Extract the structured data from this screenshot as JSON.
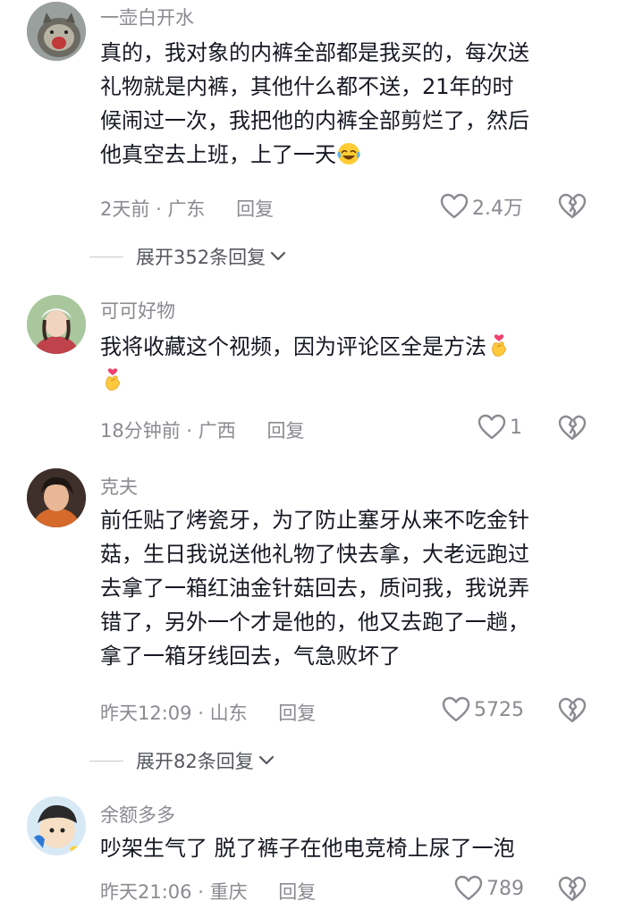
{
  "comments": [
    {
      "username": "一壶白开水",
      "lines": [
        "真的，我对象的内裤全部都是我买的，每次送",
        "礼物就是内裤，其他什么都不送，21年的时",
        "候闹过一次，我把他的内裤全部剪烂了，然后",
        "他真空去上班，上了一天"
      ],
      "emoji": "laughing-crying-emoji",
      "time": "2天前",
      "location": "广东",
      "reply_label": "回复",
      "likes": "2.4万",
      "expand": "展开352条回复"
    },
    {
      "username": "可可好物",
      "lines": [
        "我将收藏这个视频，因为评论区全是方法"
      ],
      "emoji": "finger-heart-emoji",
      "time": "18分钟前",
      "location": "广西",
      "reply_label": "回复",
      "likes": "1"
    },
    {
      "username": "克夫",
      "lines": [
        "前任贴了烤瓷牙，为了防止塞牙从来不吃金针",
        "菇，生日我说送他礼物了快去拿，大老远跑过",
        "去拿了一箱红油金针菇回去，质问我，我说弄",
        "错了，另外一个才是他的，他又去跑了一趟，",
        "拿了一箱牙线回去，气急败坏了"
      ],
      "time": "昨天12:09",
      "location": "山东",
      "reply_label": "回复",
      "likes": "5725",
      "expand": "展开82条回复"
    },
    {
      "username": "余额多多",
      "lines": [
        "吵架生气了 脱了裤子在他电竞椅上尿了一泡"
      ],
      "time": "昨天21:06",
      "location": "重庆",
      "reply_label": "回复",
      "likes": "789"
    }
  ],
  "meta_separator": "·",
  "colors": {
    "text": "#161823",
    "muted": "#8a8b91",
    "heart": "#8a8b91"
  }
}
